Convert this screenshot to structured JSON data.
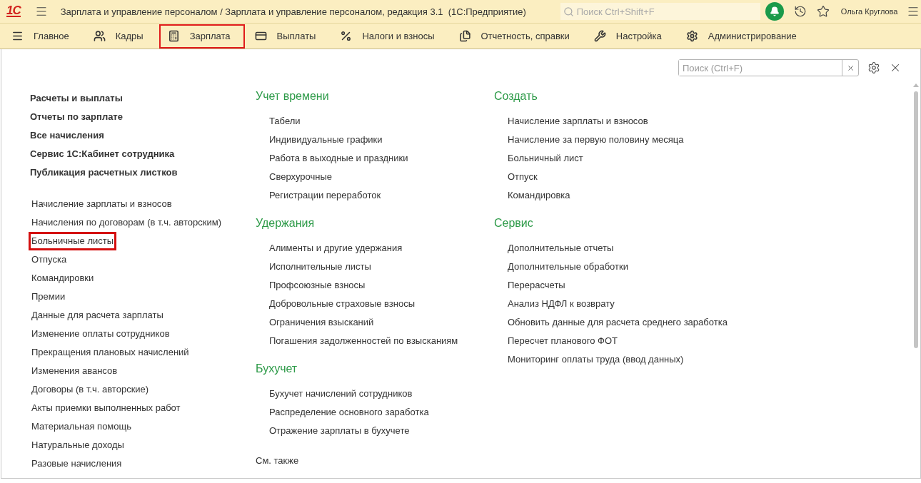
{
  "topbar": {
    "logo": "1С",
    "title": "Зарплата и управление персоналом / Зарплата и управление персоналом, редакция 3.1  (1С:Предприятие)",
    "search_placeholder": "Поиск Ctrl+Shift+F",
    "user": "Ольга Круглова"
  },
  "sections": [
    {
      "label": "Главное",
      "selected": false
    },
    {
      "label": "Кадры",
      "selected": false
    },
    {
      "label": "Зарплата",
      "selected": true
    },
    {
      "label": "Выплаты",
      "selected": false
    },
    {
      "label": "Налоги и взносы",
      "selected": false
    },
    {
      "label": "Отчетность, справки",
      "selected": false
    },
    {
      "label": "Настройка",
      "selected": false
    },
    {
      "label": "Администрирование",
      "selected": false
    }
  ],
  "panel": {
    "search_placeholder": "Поиск (Ctrl+F)",
    "featured": [
      "Расчеты и выплаты",
      "Отчеты по зарплате",
      "Все начисления",
      "Сервис 1С:Кабинет сотрудника",
      "Публикация расчетных листков"
    ],
    "links": [
      {
        "label": "Начисление зарплаты и взносов",
        "highlighted": false
      },
      {
        "label": "Начисления по договорам (в т.ч. авторским)",
        "highlighted": false
      },
      {
        "label": "Больничные листы",
        "highlighted": true
      },
      {
        "label": "Отпуска",
        "highlighted": false
      },
      {
        "label": "Командировки",
        "highlighted": false
      },
      {
        "label": "Премии",
        "highlighted": false
      },
      {
        "label": "Данные для расчета зарплаты",
        "highlighted": false
      },
      {
        "label": "Изменение оплаты сотрудников",
        "highlighted": false
      },
      {
        "label": "Прекращения плановых начислений",
        "highlighted": false
      },
      {
        "label": "Изменения авансов",
        "highlighted": false
      },
      {
        "label": "Договоры (в т.ч. авторские)",
        "highlighted": false
      },
      {
        "label": "Акты приемки выполненных работ",
        "highlighted": false
      },
      {
        "label": "Материальная помощь",
        "highlighted": false
      },
      {
        "label": "Натуральные доходы",
        "highlighted": false
      },
      {
        "label": "Разовые начисления",
        "highlighted": false
      }
    ],
    "middle_groups": [
      {
        "title": "Учет времени",
        "items": [
          "Табели",
          "Индивидуальные графики",
          "Работа в выходные и праздники",
          "Сверхурочные",
          "Регистрации переработок"
        ]
      },
      {
        "title": "Удержания",
        "items": [
          "Алименты и другие удержания",
          "Исполнительные листы",
          "Профсоюзные взносы",
          "Добровольные страховые взносы",
          "Ограничения взысканий",
          "Погашения задолженностей по взысканиям"
        ]
      },
      {
        "title": "Бухучет",
        "items": [
          "Бухучет начислений сотрудников",
          "Распределение основного заработка",
          "Отражение зарплаты в бухучете"
        ]
      }
    ],
    "see_also": "См. также",
    "right_groups": [
      {
        "title": "Создать",
        "items": [
          "Начисление зарплаты и взносов",
          "Начисление за первую половину месяца",
          "Больничный лист",
          "Отпуск",
          "Командировка"
        ]
      },
      {
        "title": "Сервис",
        "items": [
          "Дополнительные отчеты",
          "Дополнительные обработки",
          "Перерасчеты",
          "Анализ НДФЛ к возврату",
          "Обновить данные для расчета среднего заработка",
          "Пересчет планового ФОТ",
          "Мониторинг оплаты труда (ввод данных)"
        ]
      }
    ]
  }
}
